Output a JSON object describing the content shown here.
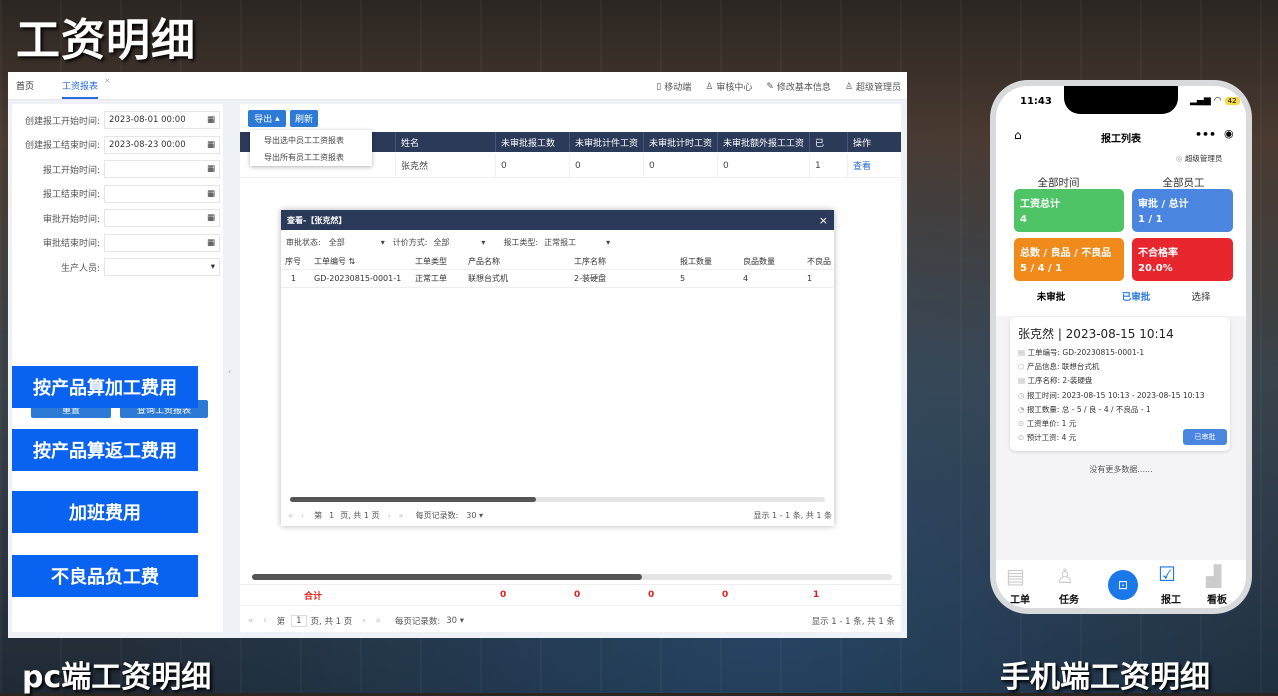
{
  "title": "工资明细",
  "pc_caption": "pc端工资明细",
  "mobile_caption": "手机端工资明细",
  "pc": {
    "tabs": [
      "首页",
      "工资报表"
    ],
    "top_links": [
      "移动端",
      "审核中心",
      "修改基本信息",
      "超级管理员"
    ],
    "filters": [
      {
        "label": "创建报工开始时间:",
        "value": "2023-08-01 00:00"
      },
      {
        "label": "创建报工结束时间:",
        "value": "2023-08-23 00:00"
      },
      {
        "label": "报工开始时间:",
        "value": ""
      },
      {
        "label": "报工结束时间:",
        "value": ""
      },
      {
        "label": "审批开始时间:",
        "value": ""
      },
      {
        "label": "审批结束时间:",
        "value": ""
      },
      {
        "label": "生产人员:",
        "value": ""
      }
    ],
    "reset": "重置",
    "query": "查询工资报表",
    "export": "导出",
    "refresh": "刷新",
    "export_menu": [
      "导出选中员工工资报表",
      "导出所有员工工资报表"
    ],
    "headers": [
      "姓名",
      "未审批报工数",
      "未审批计件工资",
      "未审批计时工资",
      "未审批额外报工工资",
      "已",
      "操作"
    ],
    "row": [
      "张克然",
      "0",
      "0",
      "0",
      "0",
      "1",
      "查看"
    ],
    "total_label": "合计",
    "totals": [
      "0",
      "0",
      "0",
      "0",
      "1"
    ],
    "pager": {
      "page_label": "第",
      "page": "1",
      "of": "页, 共 1 页",
      "per_label": "每页记录数:",
      "per": "30",
      "info": "显示 1 - 1 条, 共 1 条"
    },
    "side_buttons": [
      "按产品算加工费用",
      "按产品算返工费用",
      "加班费用",
      "不良品负工费"
    ],
    "modal": {
      "title": "查看-【张克然】",
      "filters": [
        {
          "label": "审批状态:",
          "value": "全部"
        },
        {
          "label": "计价方式:",
          "value": "全部"
        },
        {
          "label": "报工类型:",
          "value": "正常报工"
        }
      ],
      "headers": [
        "序号",
        "工单编号 ⇅",
        "工单类型",
        "产品名称",
        "工序名称",
        "报工数量",
        "良品数量",
        "不良品"
      ],
      "row": [
        "1",
        "GD-20230815-0001-1",
        "正常工单",
        "联想台式机",
        "2-装硬盘",
        "5",
        "4",
        "1"
      ],
      "pager": {
        "page_label": "第",
        "page": "1",
        "of": "页, 共 1 页",
        "per_label": "每页记录数:",
        "per": "30",
        "info": "显示 1 - 1 条, 共 1 条"
      }
    }
  },
  "mobile": {
    "time": "11:43",
    "battery": "42",
    "title": "报工列表",
    "user": "超级管理员",
    "filter_time": "全部时间",
    "filter_staff": "全部员工",
    "cards": [
      {
        "label": "工资总计",
        "value": "4",
        "color": "#4fc467"
      },
      {
        "label": "审批 / 总计",
        "value": "1 / 1",
        "color": "#4a86e0"
      },
      {
        "label": "总数 / 良品 / 不良品",
        "value": "5 / 4 / 1",
        "color": "#f08a1a"
      },
      {
        "label": "不合格率",
        "value": "20.0%",
        "color": "#e8262e"
      }
    ],
    "tabs": [
      "未审批",
      "已审批",
      "选择"
    ],
    "record": {
      "title": "张克然 | 2023-08-15 10:14",
      "lines": [
        "工单编号: GD-20230815-0001-1",
        "产品信息: 联想台式机",
        "工序名称: 2-装硬盘",
        "报工时间: 2023-08-15 10:13 - 2023-08-15 10:13",
        "报工数量: 总 - 5 / 良 - 4 / 不良品 - 1",
        "工资单价: 1 元",
        "预计工资: 4 元"
      ],
      "status": "已审批"
    },
    "no_more": "没有更多数据......",
    "nav": [
      "工单",
      "任务",
      "",
      "报工",
      "看板"
    ]
  }
}
